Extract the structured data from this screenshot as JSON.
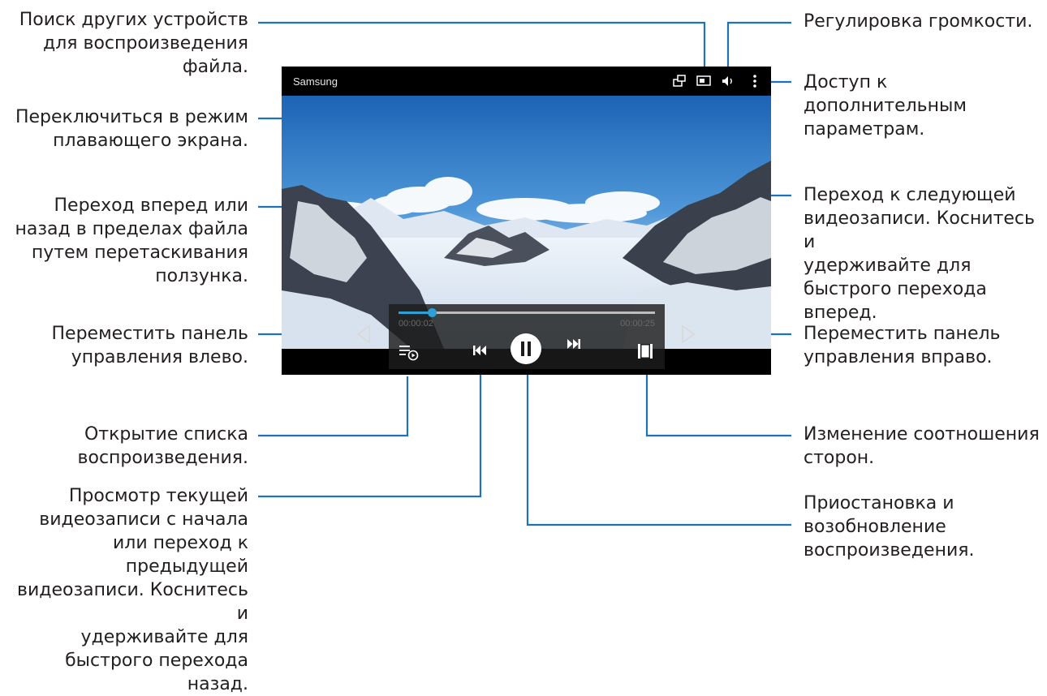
{
  "player": {
    "title": "Samsung",
    "elapsed": "00:00:02",
    "duration": "00:00:25",
    "progress": 0.13
  },
  "icons": {
    "popup": "popup-window-icon",
    "share": "screen-mirroring-icon",
    "volume": "volume-icon",
    "more": "more-options-icon",
    "prev": "previous-icon",
    "pause": "pause-icon",
    "next": "next-icon",
    "playlist": "playlist-icon",
    "ratio": "aspect-ratio-icon",
    "left_arrow": "move-left-arrow-icon",
    "right_arrow": "move-right-arrow-icon"
  },
  "callouts": {
    "search_devices": "Поиск других устройств\nдля воспроизведения\nфайла.",
    "popup_mode": "Переключиться в режим\nплавающего экрана.",
    "seek": "Переход вперед или\nназад в пределах файла\nпутем перетаскивания\nползунка.",
    "move_left": "Переместить панель\nуправления влево.",
    "playlist": "Открытие списка\nвоспроизведения.",
    "previous": "Просмотр текущей\nвидеозаписи с начала\nили переход к\nпредыдущей\nвидеозаписи. Коснитесь и\nудерживайте для\nбыстрого перехода назад.",
    "volume": "Регулировка громкости.",
    "more": "Доступ к\nдополнительным\nпараметрам.",
    "next": "Переход к следующей\nвидеозаписи. Коснитесь и\nудерживайте для\nбыстрого перехода\nвперед.",
    "move_right": "Переместить панель\nуправления вправо.",
    "ratio": "Изменение соотношения\nсторон.",
    "pause": "Приостановка и\nвозобновление\nвоспроизведения."
  },
  "colors": {
    "leader": "#1f72b8",
    "accent": "#2f9fd6"
  }
}
